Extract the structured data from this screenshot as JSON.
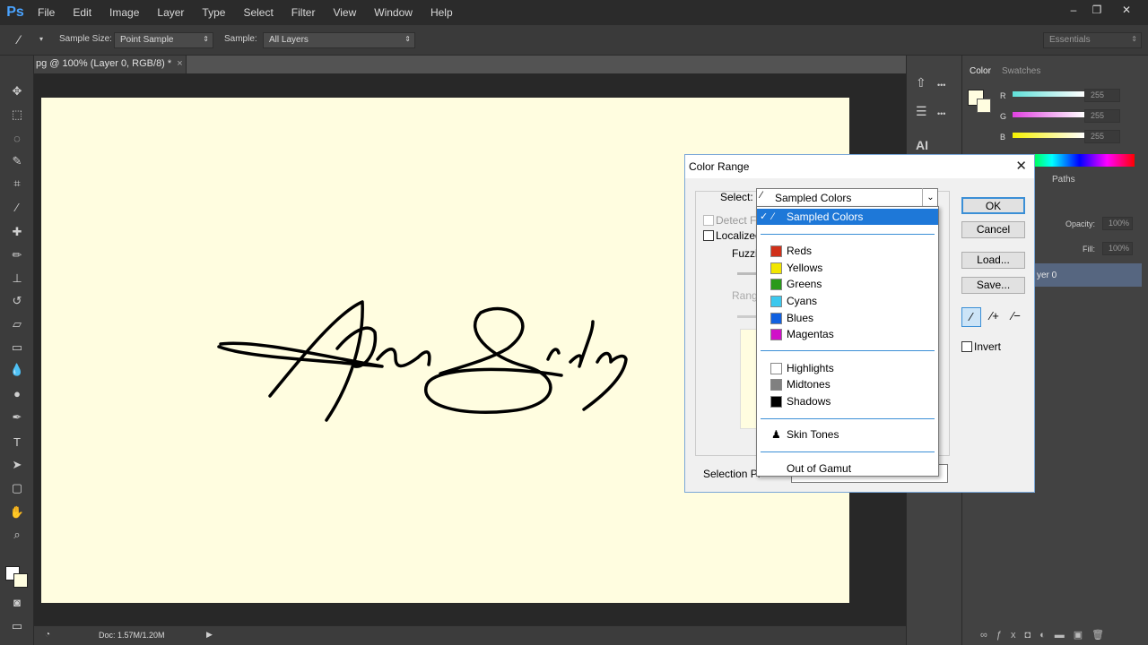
{
  "app": {
    "logo": "Ps",
    "menu": [
      "File",
      "Edit",
      "Image",
      "Layer",
      "Type",
      "Select",
      "Filter",
      "View",
      "Window",
      "Help"
    ],
    "window_buttons": [
      "–",
      "❐",
      "✕"
    ]
  },
  "options": {
    "sample_size_label": "Sample Size:",
    "sample_size_value": "Point Sample",
    "sample_label": "Sample:",
    "sample_value": "All Layers",
    "workspace": "Essentials"
  },
  "document": {
    "tab": "pg @ 100% (Layer 0, RGB/8) *",
    "status": "Doc: 1.57M/1.20M"
  },
  "panels": {
    "color_tabs": [
      "Color",
      "Swatches"
    ],
    "channels": [
      {
        "label": "R",
        "value": "255"
      },
      {
        "label": "G",
        "value": "255"
      },
      {
        "label": "B",
        "value": "255"
      }
    ],
    "paths_tab": "Paths",
    "opacity_label": "Opacity:",
    "opacity_value": "100%",
    "fill_label": "Fill:",
    "fill_value": "100%",
    "layer_name": "yer 0"
  },
  "dialog": {
    "title": "Color Range",
    "select_label": "Select:",
    "select_value": "Sampled Colors",
    "detect_faces": "Detect F",
    "localized": "Localized",
    "fuzziness": "Fuzzin",
    "range": "Range",
    "selection_preview": "Selection Pr",
    "buttons": {
      "ok": "OK",
      "cancel": "Cancel",
      "load": "Load...",
      "save": "Save..."
    },
    "invert": "Invert"
  },
  "dropdown": {
    "selected": "Sampled Colors",
    "colors": [
      {
        "label": "Reds",
        "color": "#d0301a"
      },
      {
        "label": "Yellows",
        "color": "#f2e600"
      },
      {
        "label": "Greens",
        "color": "#2a9a1a"
      },
      {
        "label": "Cyans",
        "color": "#3cc8ee"
      },
      {
        "label": "Blues",
        "color": "#1060e0"
      },
      {
        "label": "Magentas",
        "color": "#d010c8"
      }
    ],
    "tones": [
      {
        "label": "Highlights",
        "color": "#ffffff"
      },
      {
        "label": "Midtones",
        "color": "#808080"
      },
      {
        "label": "Shadows",
        "color": "#000000"
      }
    ],
    "skin": "Skin Tones",
    "gamut": "Out of Gamut"
  },
  "colors": {
    "accent": "#3b8fd6",
    "canvas": "#fffde0"
  }
}
